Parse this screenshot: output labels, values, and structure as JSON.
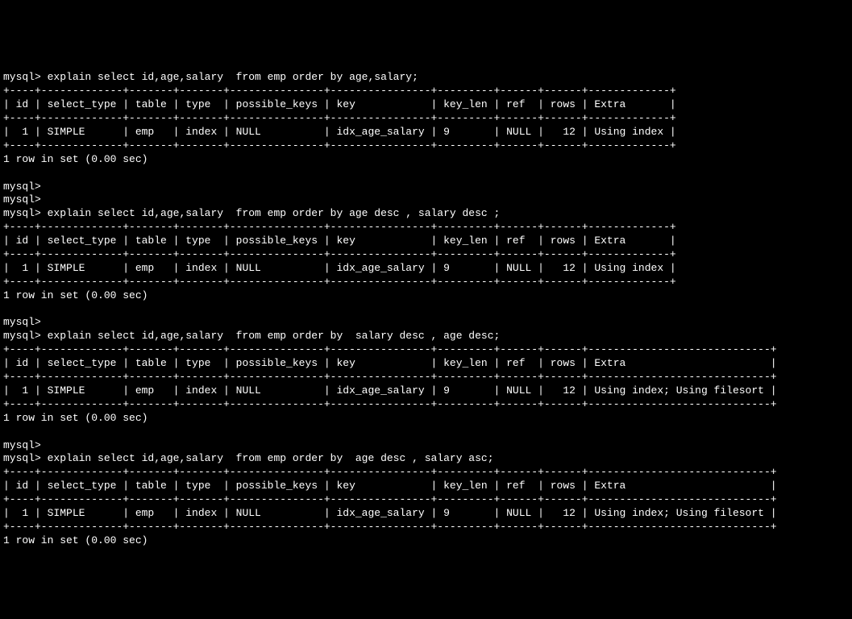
{
  "prompt": "mysql>",
  "queries": [
    {
      "sql": " explain select id,age,salary  from emp order by age,salary;",
      "border": "+----+-------------+-------+-------+---------------+----------------+---------+------+------+-------------+",
      "header": "| id | select_type | table | type  | possible_keys | key            | key_len | ref  | rows | Extra       |",
      "row": "|  1 | SIMPLE      | emp   | index | NULL          | idx_age_salary | 9       | NULL |   12 | Using index |",
      "footer": "1 row in set (0.00 sec)"
    },
    {
      "sql": " explain select id,age,salary  from emp order by age desc , salary desc ;",
      "border": "+----+-------------+-------+-------+---------------+----------------+---------+------+------+-------------+",
      "header": "| id | select_type | table | type  | possible_keys | key            | key_len | ref  | rows | Extra       |",
      "row": "|  1 | SIMPLE      | emp   | index | NULL          | idx_age_salary | 9       | NULL |   12 | Using index |",
      "footer": "1 row in set (0.00 sec)"
    },
    {
      "sql": " explain select id,age,salary  from emp order by  salary desc , age desc;",
      "border": "+----+-------------+-------+-------+---------------+----------------+---------+------+------+-----------------------------+",
      "header": "| id | select_type | table | type  | possible_keys | key            | key_len | ref  | rows | Extra                       |",
      "row": "|  1 | SIMPLE      | emp   | index | NULL          | idx_age_salary | 9       | NULL |   12 | Using index; Using filesort |",
      "footer": "1 row in set (0.00 sec)"
    },
    {
      "sql": " explain select id,age,salary  from emp order by  age desc , salary asc;",
      "border": "+----+-------------+-------+-------+---------------+----------------+---------+------+------+-----------------------------+",
      "header": "| id | select_type | table | type  | possible_keys | key            | key_len | ref  | rows | Extra                       |",
      "row": "|  1 | SIMPLE      | emp   | index | NULL          | idx_age_salary | 9       | NULL |   12 | Using index; Using filesort |",
      "footer": "1 row in set (0.00 sec)"
    }
  ],
  "chart_data": {
    "type": "table",
    "tables": [
      {
        "query": "explain select id,age,salary from emp order by age,salary;",
        "columns": [
          "id",
          "select_type",
          "table",
          "type",
          "possible_keys",
          "key",
          "key_len",
          "ref",
          "rows",
          "Extra"
        ],
        "rows": [
          [
            1,
            "SIMPLE",
            "emp",
            "index",
            "NULL",
            "idx_age_salary",
            9,
            "NULL",
            12,
            "Using index"
          ]
        ]
      },
      {
        "query": "explain select id,age,salary from emp order by age desc , salary desc ;",
        "columns": [
          "id",
          "select_type",
          "table",
          "type",
          "possible_keys",
          "key",
          "key_len",
          "ref",
          "rows",
          "Extra"
        ],
        "rows": [
          [
            1,
            "SIMPLE",
            "emp",
            "index",
            "NULL",
            "idx_age_salary",
            9,
            "NULL",
            12,
            "Using index"
          ]
        ]
      },
      {
        "query": "explain select id,age,salary from emp order by salary desc , age desc;",
        "columns": [
          "id",
          "select_type",
          "table",
          "type",
          "possible_keys",
          "key",
          "key_len",
          "ref",
          "rows",
          "Extra"
        ],
        "rows": [
          [
            1,
            "SIMPLE",
            "emp",
            "index",
            "NULL",
            "idx_age_salary",
            9,
            "NULL",
            12,
            "Using index; Using filesort"
          ]
        ]
      },
      {
        "query": "explain select id,age,salary from emp order by age desc , salary asc;",
        "columns": [
          "id",
          "select_type",
          "table",
          "type",
          "possible_keys",
          "key",
          "key_len",
          "ref",
          "rows",
          "Extra"
        ],
        "rows": [
          [
            1,
            "SIMPLE",
            "emp",
            "index",
            "NULL",
            "idx_age_salary",
            9,
            "NULL",
            12,
            "Using index; Using filesort"
          ]
        ]
      }
    ]
  }
}
